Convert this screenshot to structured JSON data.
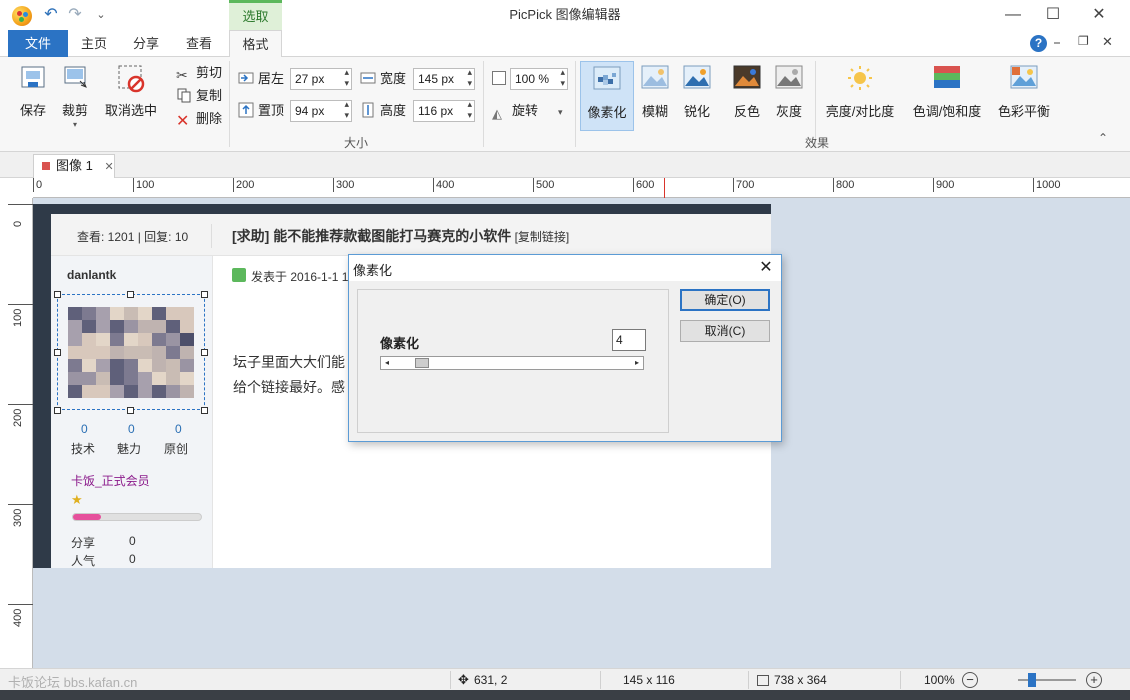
{
  "window": {
    "title": "PicPick 图像编辑器",
    "context_tab_group": "选取",
    "controls": {
      "minimize": "—",
      "maximize": "☐",
      "close": "✕"
    },
    "inner_controls": {
      "minimize": "⎯",
      "restore": "❐",
      "close": "✕"
    }
  },
  "quick_access": {
    "undo_glyph": "↶",
    "redo_glyph": "↷",
    "more_glyph": "⌄"
  },
  "tabs": {
    "file": "文件",
    "home": "主页",
    "share": "分享",
    "view": "查看",
    "format": "格式",
    "help": "?"
  },
  "ribbon": {
    "clipboard": {
      "save": "保存",
      "crop": "裁剪",
      "deselect": "取消选中",
      "cut": "剪切",
      "copy": "复制",
      "delete": "删除"
    },
    "size": {
      "left_label": "居左",
      "left_value": "27 px",
      "top_label": "置顶",
      "top_value": "94 px",
      "width_label": "宽度",
      "width_value": "145 px",
      "height_label": "高度",
      "height_value": "116 px",
      "zoom_value": "100 %",
      "rotate": "旋转",
      "group_label": "大小"
    },
    "effects": {
      "pixelate": "像素化",
      "blur": "模糊",
      "sharpen": "锐化",
      "invert": "反色",
      "grayscale": "灰度",
      "brightness": "亮度/对比度",
      "hue": "色调/饱和度",
      "color_balance": "色彩平衡",
      "group_label": "效果",
      "collapse_glyph": "⌃"
    }
  },
  "document_tab": {
    "name": "图像 1",
    "close_glyph": "✕"
  },
  "rulers": {
    "h_labels": [
      "0",
      "100",
      "200",
      "300",
      "400",
      "500",
      "600",
      "700",
      "800",
      "900",
      "1000"
    ],
    "v_labels": [
      "0",
      "100",
      "200",
      "300",
      "400"
    ]
  },
  "image": {
    "views_replies": "查看: 1201 | 回复: 10",
    "post_title": "[求助] 能不能推荐款截图能打马赛克的小软件",
    "copy_link": "[复制链接]",
    "username": "danlantk",
    "posted": "发表于 2016-1-1 1",
    "body_line1": "坛子里面大大们能",
    "body_line2": "给个链接最好。感",
    "stats": [
      {
        "value": "0",
        "label": "技术"
      },
      {
        "value": "0",
        "label": "魅力"
      },
      {
        "value": "0",
        "label": "原创"
      }
    ],
    "rank": "卡饭_正式会员",
    "progress": 0.22,
    "share_label": "分享",
    "share_value": "0",
    "popularity_label": "人气",
    "popularity_value": "0",
    "rank_color": "#8b1a8b",
    "stat_color": "#2a6fb4"
  },
  "dialog": {
    "title": "像素化",
    "close_glyph": "✕",
    "field_label": "像素化",
    "field_value": "4",
    "ok": "确定(O)",
    "cancel": "取消(C)",
    "slider_left": "◂",
    "slider_right": "▸"
  },
  "status": {
    "cursor_icon": "✥",
    "cursor_pos": "631, 2",
    "selection_size": "145 x 116",
    "image_size": "738 x 364",
    "zoom": "100%",
    "zoom_out": "−",
    "zoom_in": "+",
    "watermark": "卡饭论坛 bbs.kafan.cn"
  },
  "colors": {
    "accent": "#2b73c4",
    "canvas_bg": "#d3dde9",
    "context_green": "#5cb85c"
  }
}
